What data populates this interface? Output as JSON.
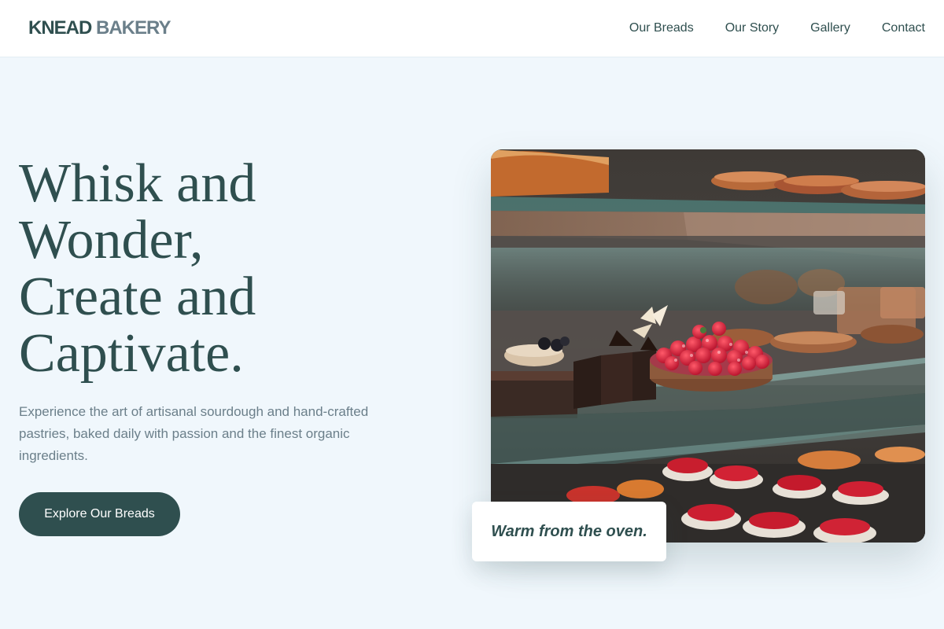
{
  "brand": {
    "part1": "KNEAD",
    "part2": "BAKERY"
  },
  "nav": [
    {
      "label": "Our Breads"
    },
    {
      "label": "Our Story"
    },
    {
      "label": "Gallery"
    },
    {
      "label": "Contact"
    }
  ],
  "hero": {
    "title_lines": [
      "Whisk and",
      "Wonder,",
      "Create and",
      "Captivate."
    ],
    "description": "Experience the art of artisanal sourdough and hand-crafted pastries, baked daily with passion and the finest organic ingredients.",
    "cta_label": "Explore Our Breads"
  },
  "image": {
    "caption": "Warm from the oven."
  },
  "colors": {
    "primary": "#2f4f4f",
    "muted": "#6b7f8a",
    "background": "#f0f7fc",
    "header": "#ffffff"
  }
}
